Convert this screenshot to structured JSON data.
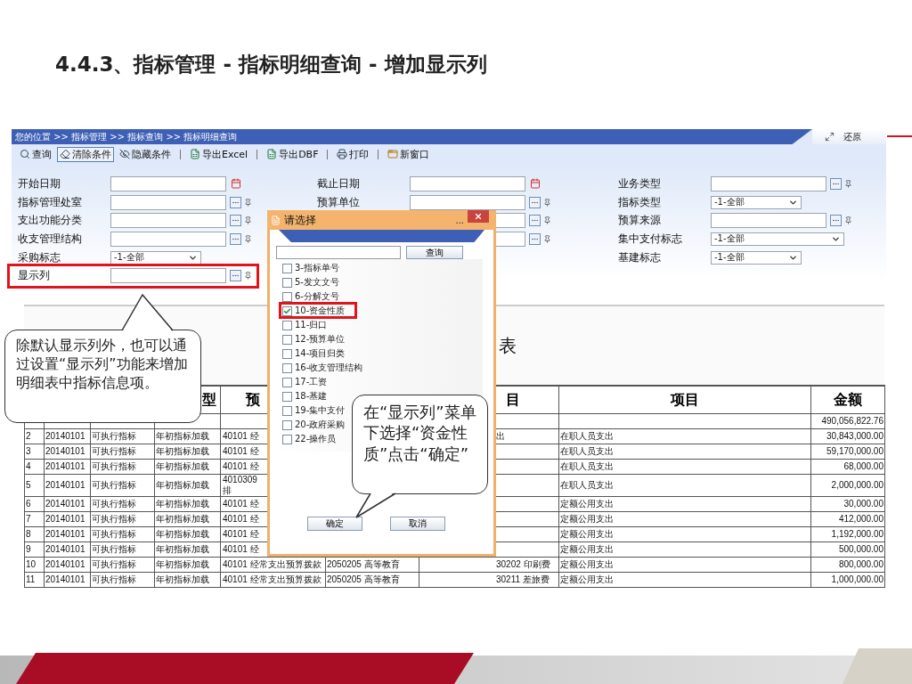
{
  "slide_title": "4.4.3、指标管理 - 指标明细查询 - 增加显示列",
  "breadcrumb": "您的位置 >> 指标管理 >> 指标查询 >> 指标明细查询",
  "restore_label": "还原",
  "toolbar": [
    {
      "label": "查询",
      "kind": "search",
      "selected": false
    },
    {
      "label": "清除条件",
      "kind": "clear",
      "selected": true
    },
    {
      "label": "隐藏条件",
      "kind": "hide",
      "selected": false
    },
    {
      "label": "导出Excel",
      "kind": "excel",
      "selected": false
    },
    {
      "label": "导出DBF",
      "kind": "excel",
      "selected": false
    },
    {
      "label": "打印",
      "kind": "print",
      "selected": false
    },
    {
      "label": "新窗口",
      "kind": "window",
      "selected": false
    }
  ],
  "form": [
    [
      {
        "label": "开始日期",
        "kind": "date",
        "highlighted": false
      },
      {
        "label": "指标管理处室",
        "kind": "lookup",
        "highlighted": false
      },
      {
        "label": "支出功能分类",
        "kind": "lookup",
        "highlighted": false
      },
      {
        "label": "收支管理结构",
        "kind": "lookup",
        "highlighted": false
      },
      {
        "label": "采购标志",
        "kind": "select",
        "value": "-1-全部",
        "wide": false,
        "highlighted": false
      },
      {
        "label": "显示列",
        "kind": "lookup",
        "highlighted": true
      }
    ],
    [
      {
        "label": "截止日期",
        "kind": "date",
        "highlighted": false
      },
      {
        "label": "预算单位",
        "kind": "lookup",
        "highlighted": false
      },
      {
        "kind": "lookup",
        "highlighted": false
      },
      {
        "kind": "lookup",
        "highlighted": false
      }
    ],
    [
      {
        "label": "业务类型",
        "kind": "lookup",
        "highlighted": false
      },
      {
        "label": "指标类型",
        "kind": "select",
        "value": "-1-全部",
        "wide": false,
        "highlighted": false
      },
      {
        "label": "预算来源",
        "kind": "lookup",
        "highlighted": false
      },
      {
        "label": "集中支付标志",
        "kind": "select",
        "value": "-1-全部",
        "wide": true,
        "highlighted": false
      },
      {
        "label": "基建标志",
        "kind": "select",
        "value": "-1-全部",
        "wide": false,
        "highlighted": false
      }
    ]
  ],
  "table": {
    "title": "表",
    "columns": [
      {},
      {},
      {},
      {
        "label": "型"
      },
      {
        "label": "预"
      },
      {},
      {
        "label": "目"
      },
      {
        "label": "项目"
      },
      {
        "label": "金额"
      }
    ],
    "rows": [
      {
        "cells": [
          null,
          null,
          null,
          null,
          null,
          null,
          null,
          null,
          "490,056,822.76"
        ]
      },
      {
        "cells": [
          "2",
          "20140101",
          "可执行指标",
          "年初指标加载",
          "40101 经",
          null,
          "出",
          "在职人员支出",
          "30,843,000.00"
        ]
      },
      {
        "cells": [
          "3",
          "20140101",
          "可执行指标",
          "年初指标加载",
          "40101 经",
          null,
          null,
          "在职人员支出",
          "59,170,000.00"
        ]
      },
      {
        "cells": [
          "4",
          "20140101",
          "可执行指标",
          "年初指标加载",
          "40101 经",
          null,
          null,
          "在职人员支出",
          "68,000.00"
        ]
      },
      {
        "cells": [
          "5",
          "20140101",
          "可执行指标",
          "年初指标加载",
          [
            "4010309",
            "排"
          ],
          null,
          null,
          "在职人员支出",
          "2,000,000.00"
        ]
      },
      {
        "cells": [
          "6",
          "20140101",
          "可执行指标",
          "年初指标加载",
          "40101 经",
          null,
          null,
          "定额公用支出",
          "30,000.00"
        ]
      },
      {
        "cells": [
          "7",
          "20140101",
          "可执行指标",
          "年初指标加载",
          "40101 经",
          null,
          null,
          "定额公用支出",
          "412,000.00"
        ]
      },
      {
        "cells": [
          "8",
          "20140101",
          "可执行指标",
          "年初指标加载",
          "40101 经",
          null,
          null,
          "定额公用支出",
          "1,192,000.00"
        ]
      },
      {
        "cells": [
          "9",
          "20140101",
          "可执行指标",
          "年初指标加载",
          "40101 经",
          null,
          null,
          "定额公用支出",
          "500,000.00"
        ]
      },
      {
        "cells": [
          "10",
          "20140101",
          "可执行指标",
          "年初指标加载",
          "40101 经常支出预算拨款",
          "2050205 高等教育",
          "30202 印刷费",
          "定额公用支出",
          "800,000.00"
        ]
      },
      {
        "cells": [
          "11",
          "20140101",
          "可执行指标",
          "年初指标加载",
          "40101 经常支出预算拨款",
          "2050205 高等教育",
          "30211 差旅费",
          "定额公用支出",
          "1,000,000.00"
        ]
      }
    ]
  },
  "dialog": {
    "title": "请选择",
    "title_extra": "...",
    "search_button": "查询",
    "options": [
      {
        "label": "3-指标单号",
        "checked": false,
        "highlighted": false
      },
      {
        "label": "5-发文文号",
        "checked": false,
        "highlighted": false
      },
      {
        "label": "6-分解文号",
        "checked": false,
        "highlighted": false
      },
      {
        "label": "10-资金性质",
        "checked": true,
        "highlighted": true
      },
      {
        "label": "11-归口",
        "checked": false,
        "highlighted": false
      },
      {
        "label": "12-预算单位",
        "checked": false,
        "highlighted": false
      },
      {
        "label": "14-项目归类",
        "checked": false,
        "highlighted": false
      },
      {
        "label": "16-收支管理结构",
        "checked": false,
        "highlighted": false
      },
      {
        "label": "17-工资",
        "checked": false,
        "highlighted": false
      },
      {
        "label": "18-基建",
        "checked": false,
        "highlighted": false
      },
      {
        "label": "19-集中支付",
        "checked": false,
        "highlighted": false
      },
      {
        "label": "20-政府采购",
        "checked": false,
        "highlighted": false
      },
      {
        "label": "22-操作员",
        "checked": false,
        "highlighted": false
      }
    ],
    "buttons": [
      "确定",
      "取消"
    ]
  },
  "callouts": [
    {
      "kind": "up",
      "text": "除默认显示列外，也可以通过设置“显示列”功能来增加明细表中指标信息项。"
    },
    {
      "kind": "down",
      "text": "在“显示列”菜单下选择“资金性质”点击“确定”"
    }
  ]
}
